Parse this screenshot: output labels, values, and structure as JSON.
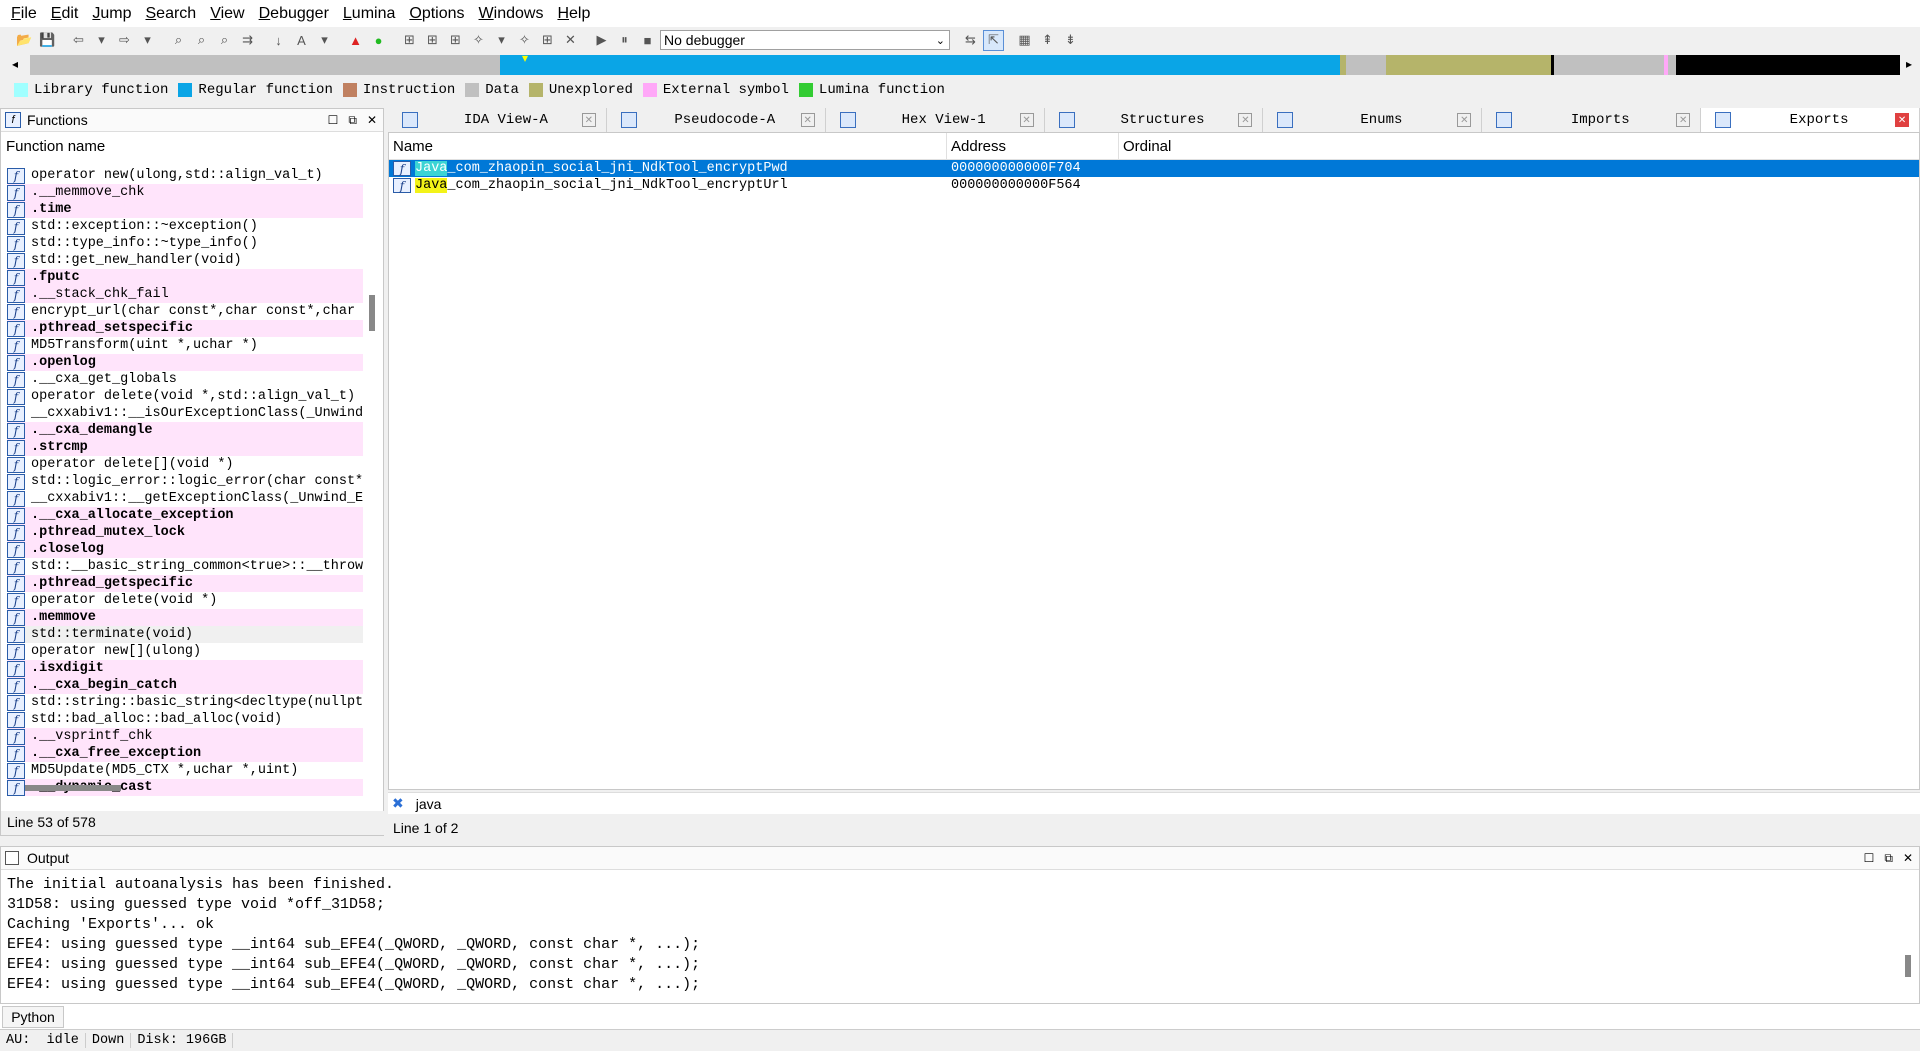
{
  "menu": [
    "File",
    "Edit",
    "Jump",
    "Search",
    "View",
    "Debugger",
    "Lumina",
    "Options",
    "Windows",
    "Help"
  ],
  "toolbar": {
    "debugger_select": "No debugger"
  },
  "legend": [
    {
      "label": "Library function",
      "color": "#a0ffff"
    },
    {
      "label": "Regular function",
      "color": "#0aa5e6"
    },
    {
      "label": "Instruction",
      "color": "#c08060"
    },
    {
      "label": "Data",
      "color": "#c0c0c0"
    },
    {
      "label": "Unexplored",
      "color": "#b5b46a"
    },
    {
      "label": "External symbol",
      "color": "#ffa8f8"
    },
    {
      "label": "Lumina function",
      "color": "#33cc33"
    }
  ],
  "functions_panel": {
    "title": "Functions",
    "column": "Function name",
    "status": "Line 53 of 578",
    "items": [
      {
        "name": "operator new(ulong,std::align_val_t)",
        "kind": "normal"
      },
      {
        "name": ".__memmove_chk",
        "kind": "ext"
      },
      {
        "name": ".time",
        "kind": "extbold"
      },
      {
        "name": "std::exception::~exception()",
        "kind": "normal"
      },
      {
        "name": "std::type_info::~type_info()",
        "kind": "normal"
      },
      {
        "name": "std::get_new_handler(void)",
        "kind": "normal"
      },
      {
        "name": ".fputc",
        "kind": "extbold"
      },
      {
        "name": ".__stack_chk_fail",
        "kind": "ext"
      },
      {
        "name": "encrypt_url(char const*,char const*,char *",
        "kind": "normal"
      },
      {
        "name": ".pthread_setspecific",
        "kind": "extbold"
      },
      {
        "name": "MD5Transform(uint *,uchar *)",
        "kind": "normal"
      },
      {
        "name": ".openlog",
        "kind": "extbold"
      },
      {
        "name": ".__cxa_get_globals",
        "kind": "normal"
      },
      {
        "name": "operator delete(void *,std::align_val_t)",
        "kind": "normal"
      },
      {
        "name": "__cxxabiv1::__isOurExceptionClass(_Unwind",
        "kind": "normal"
      },
      {
        "name": ".__cxa_demangle",
        "kind": "extbold"
      },
      {
        "name": ".strcmp",
        "kind": "extbold"
      },
      {
        "name": "operator delete[](void *)",
        "kind": "normal"
      },
      {
        "name": "std::logic_error::logic_error(char const*)",
        "kind": "normal"
      },
      {
        "name": "__cxxabiv1::__getExceptionClass(_Unwind_E",
        "kind": "normal"
      },
      {
        "name": ".__cxa_allocate_exception",
        "kind": "extbold"
      },
      {
        "name": ".pthread_mutex_lock",
        "kind": "extbold"
      },
      {
        "name": ".closelog",
        "kind": "extbold"
      },
      {
        "name": "std::__basic_string_common<true>::__throw",
        "kind": "normal"
      },
      {
        "name": ".pthread_getspecific",
        "kind": "extbold"
      },
      {
        "name": "operator delete(void *)",
        "kind": "normal"
      },
      {
        "name": ".memmove",
        "kind": "extbold"
      },
      {
        "name": "std::terminate(void)",
        "kind": "sel"
      },
      {
        "name": "operator new[](ulong)",
        "kind": "normal"
      },
      {
        "name": ".isxdigit",
        "kind": "extbold"
      },
      {
        "name": ".__cxa_begin_catch",
        "kind": "extbold"
      },
      {
        "name": "std::string::basic_string<decltype(nullpt",
        "kind": "normal"
      },
      {
        "name": "std::bad_alloc::bad_alloc(void)",
        "kind": "normal"
      },
      {
        "name": ".__vsprintf_chk",
        "kind": "ext"
      },
      {
        "name": ".__cxa_free_exception",
        "kind": "extbold"
      },
      {
        "name": "MD5Update(MD5_CTX *,uchar *,uint)",
        "kind": "normal"
      },
      {
        "name": ".__dynamic_cast",
        "kind": "extbold"
      }
    ]
  },
  "tabs": [
    {
      "label": "IDA View-A",
      "active": false
    },
    {
      "label": "Pseudocode-A",
      "active": false
    },
    {
      "label": "Hex View-1",
      "active": false
    },
    {
      "label": "Structures",
      "active": false
    },
    {
      "label": "Enums",
      "active": false
    },
    {
      "label": "Imports",
      "active": false
    },
    {
      "label": "Exports",
      "active": true
    }
  ],
  "exports": {
    "columns": [
      "Name",
      "Address",
      "Ordinal"
    ],
    "rows": [
      {
        "prefix": "Java",
        "rest": "_com_zhaopin_social_jni_NdkTool_encryptPwd",
        "address": "000000000000F704",
        "ordinal": "",
        "selected": true
      },
      {
        "prefix": "Java",
        "rest": "_com_zhaopin_social_jni_NdkTool_encryptUrl",
        "address": "000000000000F564",
        "ordinal": "",
        "selected": false
      }
    ],
    "search_text": "java",
    "status": "Line 1 of 2"
  },
  "output": {
    "title": "Output",
    "lines": [
      "The initial autoanalysis has been finished.",
      "31D58: using guessed type void *off_31D58;",
      "Caching 'Exports'... ok",
      "EFE4: using guessed type __int64 sub_EFE4(_QWORD, _QWORD, const char *, ...);",
      "EFE4: using guessed type __int64 sub_EFE4(_QWORD, _QWORD, const char *, ...);",
      "EFE4: using guessed type __int64 sub_EFE4(_QWORD, _QWORD, const char *, ...);"
    ],
    "lang_button": "Python"
  },
  "statusbar": [
    "AU:  idle",
    "Down",
    "Disk: 196GB"
  ]
}
